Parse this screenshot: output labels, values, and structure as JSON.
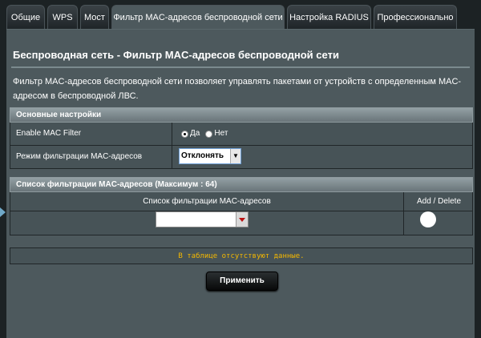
{
  "tabs": [
    {
      "label": "Общие"
    },
    {
      "label": "WPS"
    },
    {
      "label": "Мост"
    },
    {
      "label": "Фильтр MAC-адресов беспроводной сети"
    },
    {
      "label": "Настройка RADIUS"
    },
    {
      "label": "Профессионально"
    }
  ],
  "page": {
    "title": "Беспроводная сеть - Фильтр MAC-адресов беспроводной сети",
    "description": "Фильтр MAC-адресов беспроводной сети позволяет управлять пакетами от устройств с определенным MAC-адресом в беспроводной ЛВС."
  },
  "basic_settings": {
    "header": "Основные настройки",
    "enable_label": "Enable MAC Filter",
    "yes_label": "Да",
    "no_label": "Нет",
    "enabled": "Да",
    "mode_label": "Режим фильтрации MAC-адресов",
    "mode_value": "Отклонять"
  },
  "filter_list": {
    "header": "Список фильтрации MAC-адресов (Максимум : 64)",
    "col_mac": "Список фильтрации MAC-адресов",
    "col_action": "Add / Delete",
    "add_symbol": "+",
    "empty_message": "В таблице отсутствуют данные."
  },
  "apply_label": "Применить",
  "colors": {
    "background": "#1c2224",
    "panel": "#4d595d",
    "empty_text": "#f5b800"
  }
}
